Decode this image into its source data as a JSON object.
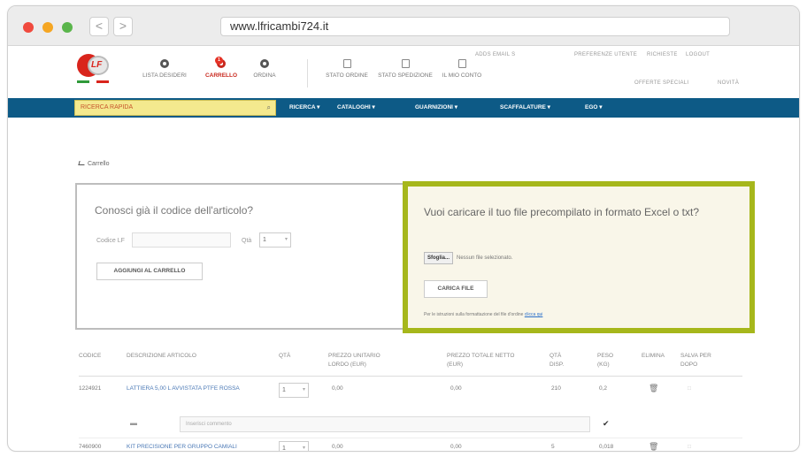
{
  "browser": {
    "url": "www.lfricambi724.it",
    "back": "<",
    "forward": ">"
  },
  "header": {
    "logo_text": "LF",
    "icons": [
      {
        "label": "LISTA DESIDERI",
        "icon": "heart-icon"
      },
      {
        "label": "CARRELLO",
        "icon": "cart-icon",
        "badge": "1"
      },
      {
        "label": "ORDINA",
        "icon": "order-icon"
      },
      {
        "label": "STATO ORDINE",
        "icon": "order-status-icon"
      },
      {
        "label": "STATO SPEDIZIONE",
        "icon": "truck-icon"
      },
      {
        "label": "IL MIO CONTO",
        "icon": "account-icon"
      }
    ],
    "top_links": {
      "user": "ADDS EMAIL S",
      "prefs": "PREFERENZE UTENTE",
      "contacts": "RICHIESTE",
      "logout": "LOGOUT",
      "offers": "OFFERTE SPECIALI",
      "news": "NOVITÀ"
    }
  },
  "nav": {
    "quick_search": "RICERCA RAPIDA",
    "items": [
      "RICERCA ▾",
      "CATALOGHI ▾",
      "GUARNIZIONI ▾",
      "SCAFFALATURE ▾",
      "EGO ▾"
    ]
  },
  "breadcrumb": "Carrello",
  "code_box": {
    "title": "Conosci già il codice dell'articolo?",
    "code_label": "Codice LF",
    "qty_label": "Qtà",
    "qty_value": "1",
    "add_button": "AGGIUNGI AL CARRELLO"
  },
  "upload_box": {
    "title": "Vuoi caricare il tuo file precompilato in formato Excel o txt?",
    "browse_button": "Sfoglia...",
    "no_file": "Nessun file selezionato.",
    "upload_button": "CARICA FILE",
    "note": "Per le istruzioni sulla formattazione del file d'ordine",
    "note_link": "clicca qui"
  },
  "table": {
    "headers": [
      "CODICE",
      "DESCRIZIONE ARTICOLO",
      "QTÀ",
      "PREZZO UNITARIO LORDO (EUR)",
      "PREZZO TOTALE NETTO (EUR)",
      "QTÀ DISP.",
      "PESO (KG)",
      "ELIMINA",
      "SALVA PER DOPO"
    ],
    "rows": [
      {
        "code": "1224921",
        "desc": "LATTIERA 5,00 L AVVISTATA PTFE ROSSA",
        "qty": "1",
        "unit": "0,00",
        "total": "0,00",
        "avail": "210",
        "weight": "0,2"
      },
      {
        "code": "7460900",
        "desc": "KIT PRECISIONE PER GRUPPO CAMIALI",
        "qty": "1",
        "unit": "0,00",
        "total": "0,00",
        "avail": "5",
        "weight": "0,018"
      }
    ],
    "note_placeholder": "Inserisci commento"
  }
}
